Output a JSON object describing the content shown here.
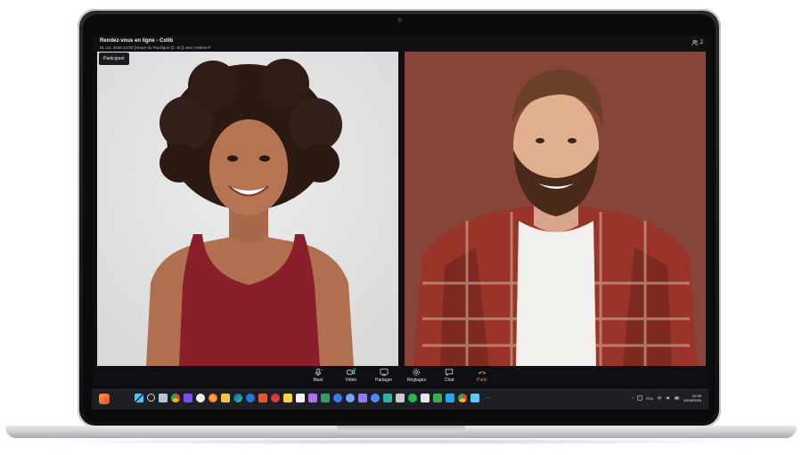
{
  "meeting": {
    "title": "Rendez-vous en ligne - Colib",
    "subtitle": "01 oct. 2026 14:00 (Heure du Pacifique (C.-B.)) avec Helene F",
    "participant_count": "2",
    "participant_label": "Participant"
  },
  "controls": [
    {
      "label": "Muet",
      "icon": "microphone-icon"
    },
    {
      "label": "Vidéo",
      "icon": "video-camera-icon"
    },
    {
      "label": "Partager",
      "icon": "screen-share-icon"
    },
    {
      "label": "Réglages",
      "icon": "gear-icon"
    },
    {
      "label": "Chat",
      "icon": "chat-bubble-icon"
    },
    {
      "label": "Partir",
      "icon": "phone-hangup-icon"
    }
  ],
  "taskbar": {
    "language": "FRA",
    "time": "02:58",
    "date": "25/08/2026",
    "icons": [
      "windows-start-icon",
      "search-icon",
      "task-view-icon",
      "chrome-icon",
      "app-icon",
      "app-icon",
      "firefox-icon",
      "folder-icon",
      "edge-icon",
      "app-icon",
      "app-icon",
      "app-icon",
      "app-icon",
      "app-icon",
      "app-icon",
      "app-icon",
      "app-icon",
      "app-icon",
      "app-icon",
      "app-icon",
      "app-icon",
      "app-icon",
      "app-icon",
      "app-icon",
      "spotify-icon",
      "app-icon",
      "app-icon",
      "vscode-icon",
      "chrome-icon",
      "app-icon"
    ]
  },
  "colors": {
    "leave": "#ff6b6b",
    "active_ring": "#2ad1c6",
    "taskbar_bg": "#1d1f24"
  }
}
